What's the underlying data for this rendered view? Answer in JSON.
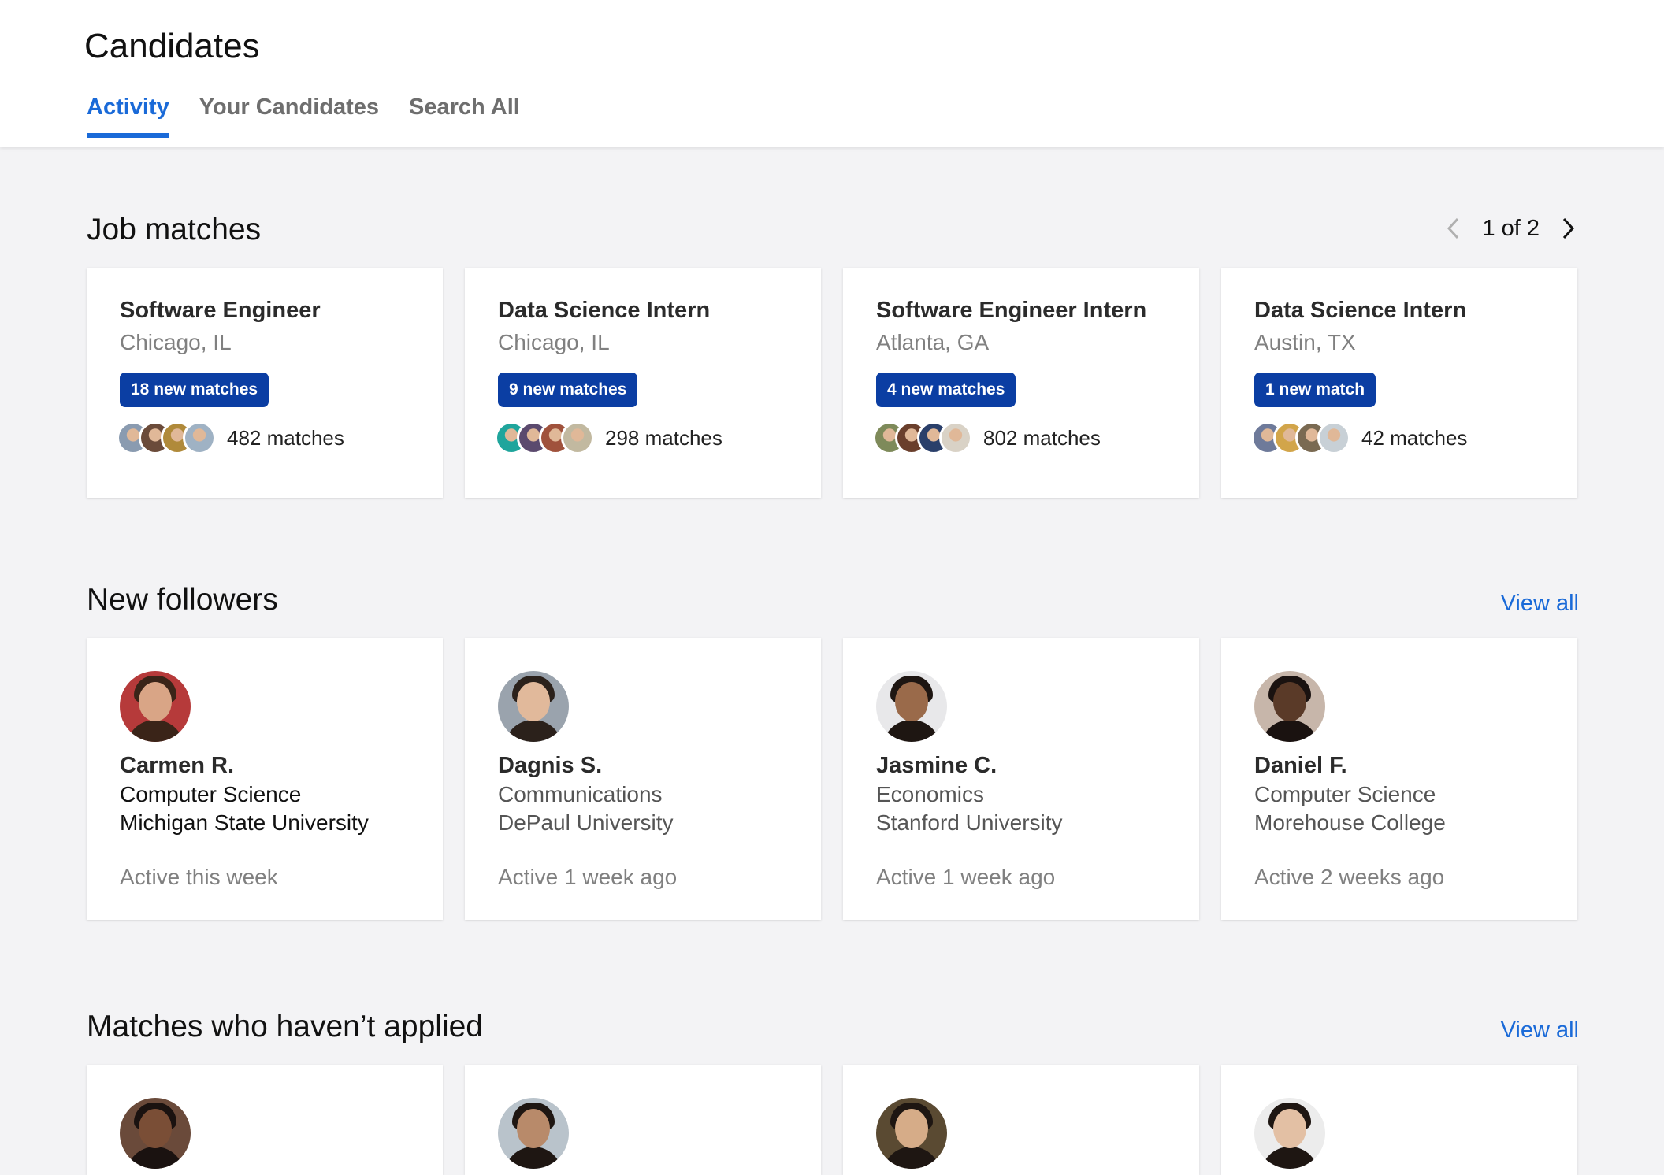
{
  "header": {
    "title": "Candidates",
    "tabs": [
      {
        "label": "Activity",
        "active": true
      },
      {
        "label": "Your Candidates",
        "active": false
      },
      {
        "label": "Search All",
        "active": false
      }
    ]
  },
  "colors": {
    "accent": "#1a6ad8",
    "badge": "#0b3ea3",
    "background": "#f3f3f5"
  },
  "job_matches": {
    "title": "Job matches",
    "pager": "1 of 2",
    "cards": [
      {
        "title": "Software Engineer",
        "location": "Chicago, IL",
        "badge": "18 new matches",
        "matches": "482 matches",
        "avatar_colors": [
          "#8a9bb0",
          "#6b4b3a",
          "#b08a3a",
          "#9fb2c4"
        ]
      },
      {
        "title": "Data Science Intern",
        "location": "Chicago, IL",
        "badge": "9 new matches",
        "matches": "298 matches",
        "avatar_colors": [
          "#1fa59c",
          "#5b4a6e",
          "#a0523c",
          "#c2b9a0"
        ]
      },
      {
        "title": "Software Engineer Intern",
        "location": "Atlanta, GA",
        "badge": "4 new matches",
        "matches": "802 matches",
        "avatar_colors": [
          "#7e8a5a",
          "#6a3f2c",
          "#2a3f6a",
          "#d9d2c6"
        ]
      },
      {
        "title": "Data Science Intern",
        "location": "Austin, TX",
        "badge": "1 new match",
        "matches": "42 matches",
        "avatar_colors": [
          "#6e7a9a",
          "#d2a54a",
          "#7a6a52",
          "#c8d0d6"
        ]
      }
    ]
  },
  "new_followers": {
    "title": "New followers",
    "view_all": "View all",
    "cards": [
      {
        "name": "Carmen R.",
        "major": "Computer Science",
        "school": "Michigan State University",
        "active": "Active this week",
        "bg": "#b63a3a",
        "skin": "#d9a586",
        "hair": "#3a2418"
      },
      {
        "name": "Dagnis S.",
        "major": "Communications",
        "school": "DePaul University",
        "active": "Active 1 week ago",
        "bg": "#9aa3ad",
        "skin": "#e1b99b",
        "hair": "#2b211b"
      },
      {
        "name": "Jasmine C.",
        "major": "Economics",
        "school": "Stanford University",
        "active": "Active 1 week ago",
        "bg": "#e8e8ea",
        "skin": "#9a6a4a",
        "hair": "#1e1612"
      },
      {
        "name": "Daniel F.",
        "major": "Computer Science",
        "school": "Morehouse College",
        "active": "Active 2 weeks ago",
        "bg": "#c7b6aa",
        "skin": "#5a3a28",
        "hair": "#1a1210"
      }
    ]
  },
  "matches_not_applied": {
    "title": "Matches who haven’t applied",
    "view_all": "View all",
    "avatars": [
      {
        "bg": "#6a4a3a",
        "skin": "#7a4e36",
        "hair": "#1a1210"
      },
      {
        "bg": "#b9c3cb",
        "skin": "#b88a6a",
        "hair": "#1e1612"
      },
      {
        "bg": "#5a4a32",
        "skin": "#d6ac88",
        "hair": "#1e1612"
      },
      {
        "bg": "#ececec",
        "skin": "#e3c0a4",
        "hair": "#1e1612"
      }
    ]
  }
}
